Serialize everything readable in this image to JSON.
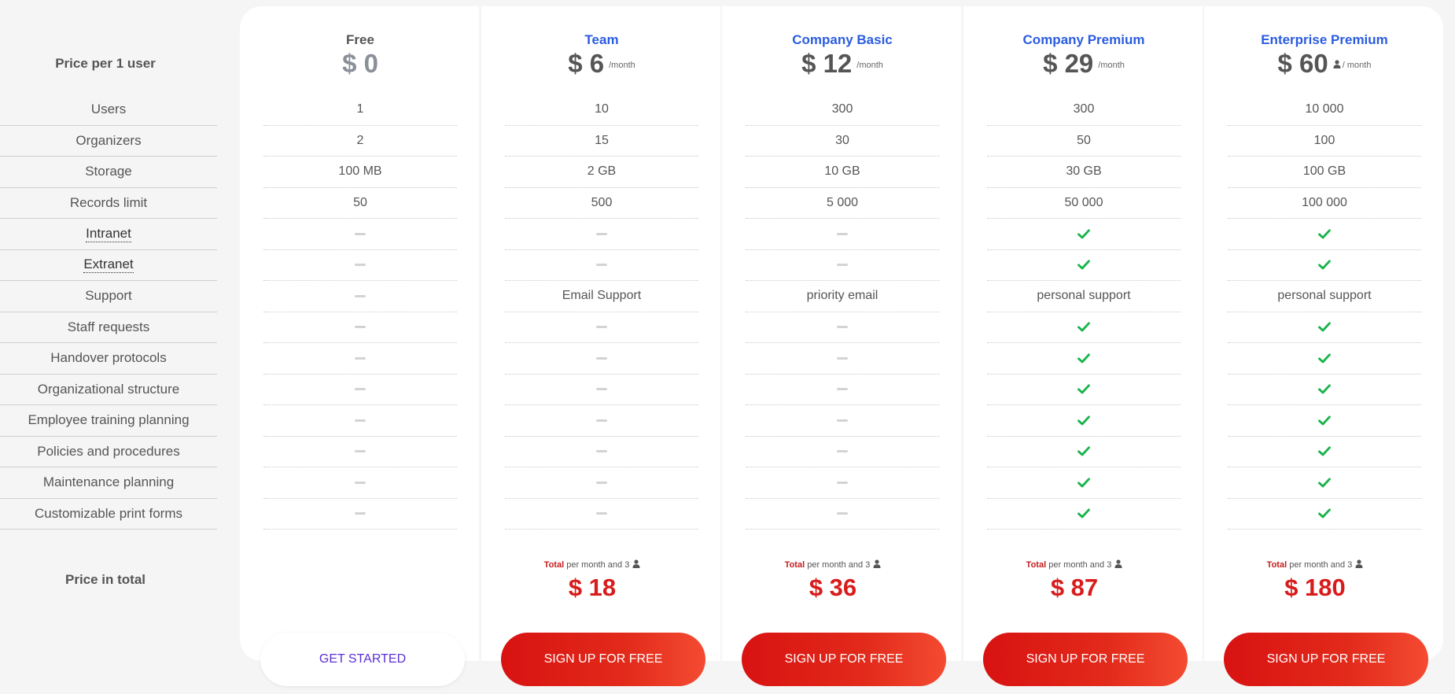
{
  "labels": {
    "price_per_user": "Price per 1 user",
    "price_in_total": "Price in total",
    "rows": [
      "Users",
      "Organizers",
      "Storage",
      "Records limit",
      "Intranet",
      "Extranet",
      "Support",
      "Staff requests",
      "Handover protocols",
      "Organizational structure",
      "Employee training planning",
      "Policies and procedures",
      "Maintenance planning",
      "Customizable print forms"
    ],
    "dotted_rows": [
      4,
      5
    ]
  },
  "colors": {
    "plan_name_blue": "#2b5ce0",
    "plan_name_free": "#555555",
    "check_green": "#16b34a",
    "total_red": "#d81c1c"
  },
  "plans": [
    {
      "name": "Free",
      "price": "$ 0",
      "period": "",
      "cells": [
        "1",
        "2",
        "100 MB",
        "50",
        "-",
        "-",
        "-",
        "-",
        "-",
        "-",
        "-",
        "-",
        "-",
        "-"
      ],
      "total_label": "",
      "total_text": "",
      "total": "",
      "button": "GET STARTED",
      "button_style": "white"
    },
    {
      "name": "Team",
      "price": "$ 6",
      "period": "/month",
      "cells": [
        "10",
        "15",
        "2 GB",
        "500",
        "-",
        "-",
        "Email Support",
        "-",
        "-",
        "-",
        "-",
        "-",
        "-",
        "-"
      ],
      "total_label": "Total",
      "total_text": "per month and 3",
      "total": "$ 18",
      "button": "SIGN UP FOR FREE",
      "button_style": "red"
    },
    {
      "name": "Company Basic",
      "price": "$ 12",
      "period": "/month",
      "cells": [
        "300",
        "30",
        "10 GB",
        "5 000",
        "-",
        "-",
        "priority email",
        "-",
        "-",
        "-",
        "-",
        "-",
        "-",
        "-"
      ],
      "total_label": "Total",
      "total_text": "per month and 3",
      "total": "$ 36",
      "button": "SIGN UP FOR FREE",
      "button_style": "red"
    },
    {
      "name": "Company Premium",
      "price": "$ 29",
      "period": "/month",
      "cells": [
        "300",
        "50",
        "30 GB",
        "50 000",
        "check",
        "check",
        "personal support",
        "check",
        "check",
        "check",
        "check",
        "check",
        "check",
        "check"
      ],
      "total_label": "Total",
      "total_text": "per month and 3",
      "total": "$ 87",
      "button": "SIGN UP FOR FREE",
      "button_style": "red"
    },
    {
      "name": "Enterprise Premium",
      "price": "$ 60",
      "period": "/ month",
      "period_user_icon": true,
      "cells": [
        "10 000",
        "100",
        "100 GB",
        "100 000",
        "check",
        "check",
        "personal support",
        "check",
        "check",
        "check",
        "check",
        "check",
        "check",
        "check"
      ],
      "total_label": "Total",
      "total_text": "per month and 3",
      "total": "$ 180",
      "button": "SIGN UP FOR FREE",
      "button_style": "red"
    }
  ]
}
